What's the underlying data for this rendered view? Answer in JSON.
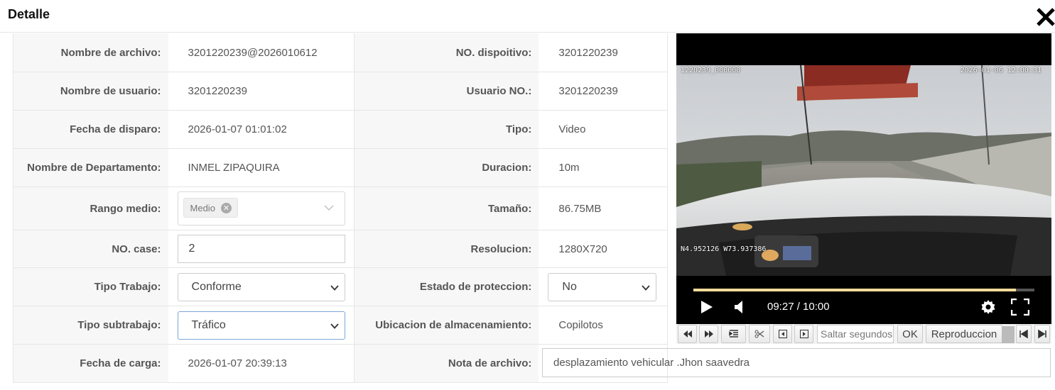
{
  "dialog": {
    "title": "Detalle"
  },
  "fields": {
    "nombre_archivo": {
      "label": "Nombre de archivo:",
      "value": "3201220239@2026010612"
    },
    "no_dispositivo": {
      "label": "NO. dispoitivo:",
      "value": "3201220239"
    },
    "nombre_usuario": {
      "label": "Nombre de usuario:",
      "value": "3201220239"
    },
    "usuario_no": {
      "label": "Usuario NO.:",
      "value": "3201220239"
    },
    "fecha_disparo": {
      "label": "Fecha de disparo:",
      "value": "2026-01-07 01:01:02"
    },
    "tipo": {
      "label": "Tipo:",
      "value": "Video"
    },
    "departamento": {
      "label": "Nombre de Departamento:",
      "value": "INMEL ZIPAQUIRA"
    },
    "duracion": {
      "label": "Duracion:",
      "value": "10m"
    },
    "rango_medio": {
      "label": "Rango medio:",
      "tag": "Medio"
    },
    "tamano": {
      "label": "Tamaño:",
      "value": "86.75MB"
    },
    "no_case": {
      "label": "NO. case:",
      "value": "2"
    },
    "resolucion": {
      "label": "Resolucion:",
      "value": "1280X720"
    },
    "tipo_trabajo": {
      "label": "Tipo Trabajo:",
      "value": "Conforme"
    },
    "estado_proteccion": {
      "label": "Estado de proteccion:",
      "value": "No"
    },
    "tipo_subtrabajo": {
      "label": "Tipo subtrabajo:",
      "value": "Tráfico"
    },
    "ubicacion": {
      "label": "Ubicacion de almacenamiento:",
      "value": "Copilotos"
    },
    "fecha_carga": {
      "label": "Fecha de carga:",
      "value": "2026-01-07 20:39:13"
    },
    "nota": {
      "label": "Nota de archivo:",
      "value": "desplazamiento vehicular .Jhon saavedra"
    }
  },
  "player": {
    "osd_channel": "1220239_000000",
    "osd_datetime": "2026-01-06 12:00:31",
    "osd_gps": "N4.952126  W73.937386",
    "time_display": "09:27 / 10:00",
    "progress": 0.945
  },
  "toolbar": {
    "seek_placeholder": "Saltar segundos",
    "ok_label": "OK",
    "playback_label": "Reproduccion"
  },
  "icons": [
    "close-icon",
    "play-icon",
    "volume-icon",
    "gear-icon",
    "fullscreen-icon",
    "rewind-icon",
    "fast-forward-icon",
    "list-icon",
    "scissors-icon",
    "frame-back-icon",
    "frame-forward-icon",
    "skip-start-icon",
    "skip-end-icon",
    "chevron-down-icon"
  ],
  "colors": {
    "progress_fill": "#f3dd9a",
    "focus_border": "#7aa7d6",
    "label_bg": "#f7f7f7"
  }
}
